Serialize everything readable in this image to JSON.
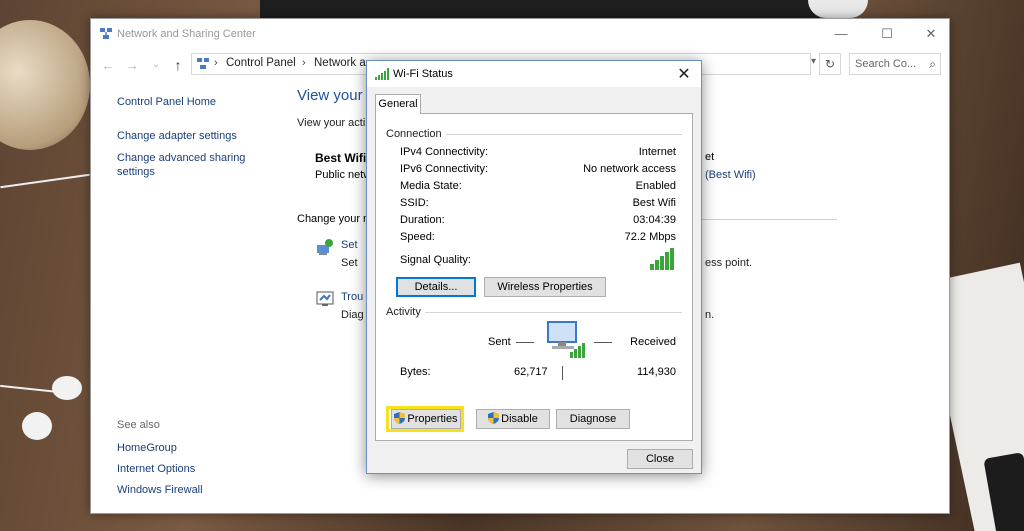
{
  "window": {
    "title": "Network and Sharing Center",
    "minimize": "—",
    "maximize": "☐",
    "close": "✕"
  },
  "address": {
    "crumbs": [
      "Control Panel",
      "Network a"
    ],
    "refresh": "↻",
    "dropdown": "▾",
    "search_placeholder": "Search Co...",
    "search_icon": "⌕"
  },
  "nav": {
    "back": "←",
    "forward": "→",
    "recent": "⌄",
    "up": "↑"
  },
  "left_pane": {
    "links": [
      "Control Panel Home",
      "Change adapter settings",
      "Change advanced sharing settings"
    ],
    "see_also": "See also",
    "see_also_links": [
      "HomeGroup",
      "Internet Options",
      "Windows Firewall"
    ]
  },
  "content": {
    "heading": "View your",
    "subheading": "View your acti",
    "network_name": "Best Wifi",
    "network_type": "Public netw",
    "right_fragment_1": "et",
    "right_fragment_2": "(Best Wifi)",
    "change_label": "Change your n",
    "item1_link": "Set",
    "item1_desc": "Set",
    "item1_desc_right": "ess point.",
    "item2_link": "Trou",
    "item2_desc": "Diag",
    "item2_desc_right": "n."
  },
  "dialog": {
    "title": "Wi-Fi Status",
    "close": "✕",
    "tab": "General",
    "connection_label": "Connection",
    "rows": [
      {
        "label": "IPv4 Connectivity:",
        "value": "Internet"
      },
      {
        "label": "IPv6 Connectivity:",
        "value": "No network access"
      },
      {
        "label": "Media State:",
        "value": "Enabled"
      },
      {
        "label": "SSID:",
        "value": "Best Wifi"
      },
      {
        "label": "Duration:",
        "value": "03:04:39"
      },
      {
        "label": "Speed:",
        "value": "72.2 Mbps"
      }
    ],
    "signal_label": "Signal Quality:",
    "signal_bars": 5,
    "details_btn": "Details...",
    "wireless_btn": "Wireless Properties",
    "activity_label": "Activity",
    "sent_label": "Sent",
    "received_label": "Received",
    "bytes_label": "Bytes:",
    "bytes_sent": "62,717",
    "bytes_received": "114,930",
    "properties_btn": "Properties",
    "disable_btn": "Disable",
    "diagnose_btn": "Diagnose",
    "close_btn": "Close"
  },
  "colors": {
    "accent": "#0078d7",
    "link": "#1a3f7a",
    "highlight": "#f5e21d",
    "signal": "#3ba53b"
  }
}
